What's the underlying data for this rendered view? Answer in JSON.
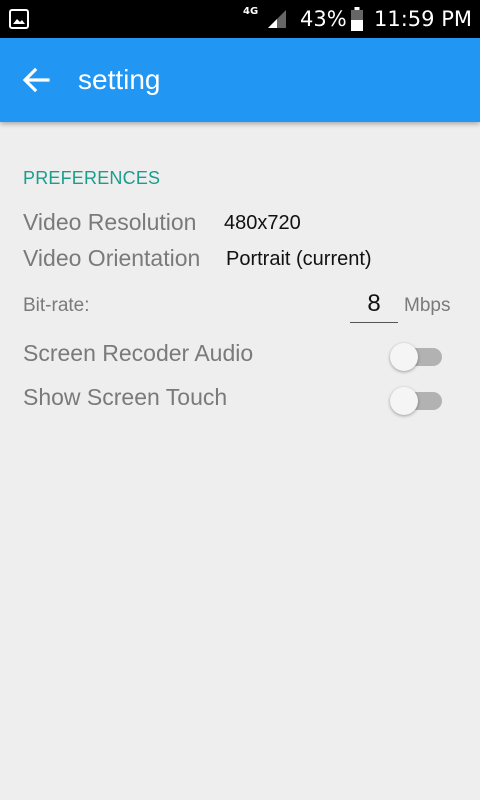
{
  "status_bar": {
    "network": "4G",
    "battery_percent": "43%",
    "time": "11:59 PM"
  },
  "app_bar": {
    "title": "setting",
    "back_icon": "arrow-left-icon",
    "color": "#2196f3"
  },
  "preferences": {
    "header": "PREFERENCES",
    "header_color": "#1a9e8c",
    "video_resolution": {
      "label": "Video Resolution",
      "value": "480x720"
    },
    "video_orientation": {
      "label": "Video Orientation",
      "value": "Portrait (current)"
    },
    "bitrate": {
      "label": "Bit-rate:",
      "value": "8",
      "unit": "Mbps"
    },
    "screen_recorder_audio": {
      "label": "Screen Recoder Audio",
      "enabled": false
    },
    "show_screen_touch": {
      "label": "Show Screen Touch",
      "enabled": false
    }
  }
}
